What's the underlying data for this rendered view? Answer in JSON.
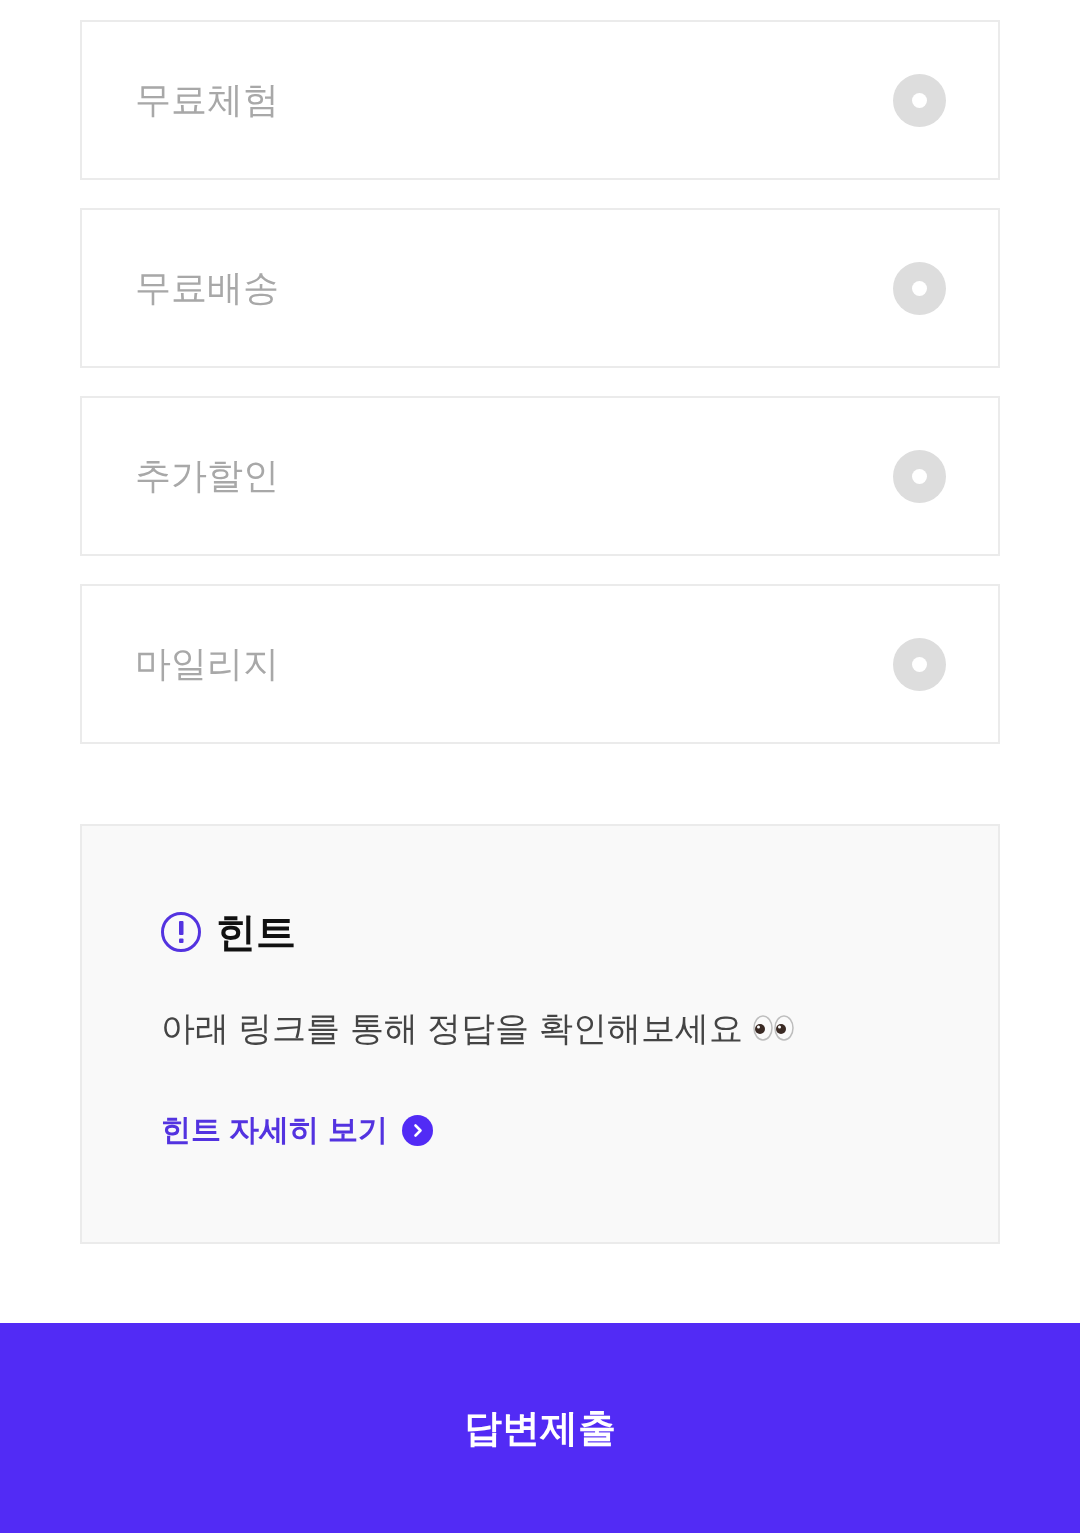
{
  "options": [
    {
      "label": "무료체험",
      "selected": false
    },
    {
      "label": "무료배송",
      "selected": false
    },
    {
      "label": "추가할인",
      "selected": false
    },
    {
      "label": "마일리지",
      "selected": false
    }
  ],
  "hint": {
    "title": "힌트",
    "text": "아래 링크를 통해 정답을 확인해보세요",
    "link": "힌트 자세히 보기"
  },
  "submit_button": "답변제출"
}
